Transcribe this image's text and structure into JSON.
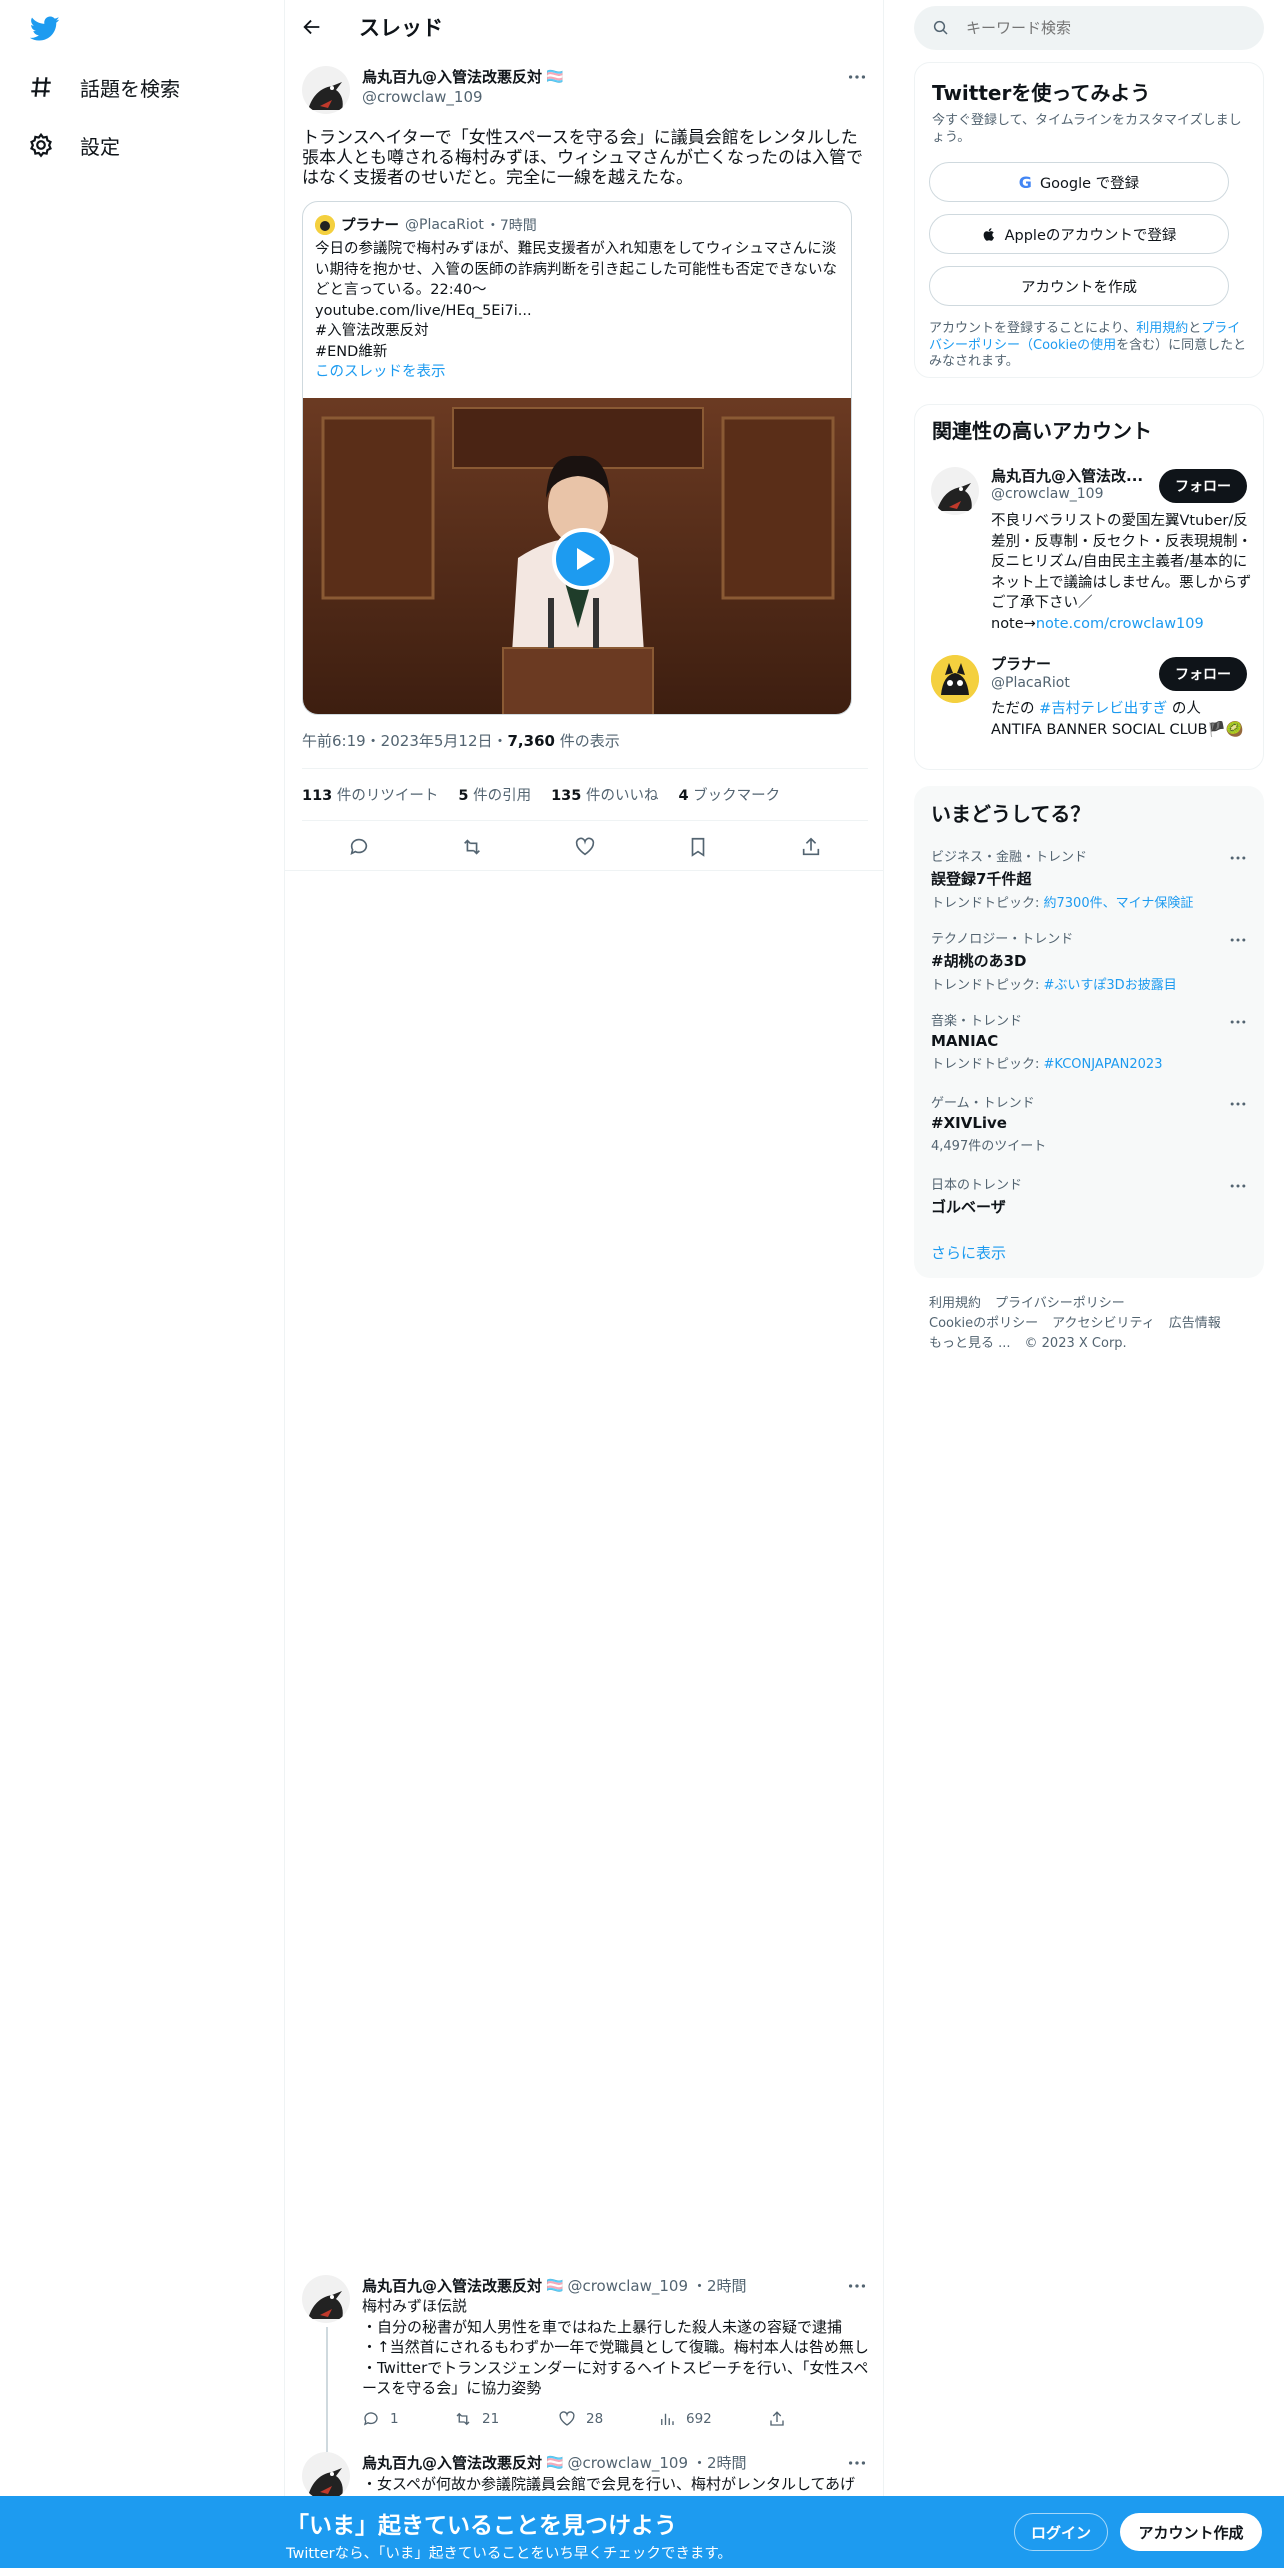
{
  "nav": {
    "explore_label": "話題を検索",
    "settings_label": "設定"
  },
  "header": {
    "title": "スレッド"
  },
  "tweet": {
    "name": "烏丸百九@入管法改悪反対",
    "flag": "🏳️‍⚧️",
    "handle": "@crowclaw_109",
    "text": "トランスヘイターで「女性スペースを守る会」に議員会館をレンタルした張本人とも噂される梅村みずほ、ウィシュマさんが亡くなったのは入管ではなく支援者のせいだと。完全に一線を越えたな。",
    "quote": {
      "name": "プラナー",
      "handle": "@PlacaRiot",
      "time": "・7時間",
      "text_lines": [
        "今日の参議院で梅村みずほが、難民支援者が入れ知恵をしてウィシュマさんに淡い期待を抱かせ、入管の医師の詐病判断を引き起こした可能性も否定できないなどと言っている。22:40〜",
        "youtube.com/live/HEq_5Ei7i...",
        "#入管法改悪反対",
        "#END維新"
      ],
      "show_thread": "このスレッドを表示"
    },
    "time": "午前6:19・2023年5月12日・",
    "views": "7,360",
    "views_label": " 件の表示",
    "retweets": "113",
    "retweets_label": " 件のリツイート",
    "quotes": "5",
    "quotes_label": " 件の引用",
    "likes": "135",
    "likes_label": " 件のいいね",
    "bookmarks": "4",
    "bookmarks_label": " ブックマーク"
  },
  "replies": [
    {
      "name": "烏丸百九@入管法改悪反対",
      "flag": "🏳️‍⚧️",
      "handle": "@crowclaw_109",
      "time": "・2時間",
      "text_lines": [
        "梅村みずほ伝説",
        "・自分の秘書が知人男性を車ではねた上暴行した殺人未遂の容疑で逮捕",
        "・↑当然首にされるもわずか一年で党職員として復職。梅村本人は咎め無し",
        "・Twitterでトランスジェンダーに対するヘイトスピーチを行い、「女性スペースを守る会」に協力姿勢"
      ],
      "replies": "1",
      "retweets": "21",
      "likes": "28",
      "views": "692"
    },
    {
      "name": "烏丸百九@入管法改悪反対",
      "flag": "🏳️‍⚧️",
      "handle": "@crowclaw_109",
      "time": "・2時間",
      "text_lines": [
        "・女スペが何故か参議院議員会館で会見を行い、梅村がレンタルしてあげ"
      ]
    }
  ],
  "right": {
    "search_placeholder": "キーワード検索",
    "signup": {
      "title": "Twitterを使ってみよう",
      "subtitle": "今すぐ登録して、タイムラインをカスタマイズしましょう。",
      "google": "Google で登録",
      "apple": "Appleのアカウントで登録",
      "create": "アカウントを作成",
      "terms_pre": "アカウントを登録することにより、",
      "terms_link1": "利用規約",
      "terms_mid": "と",
      "terms_link2": "プライバシーポリシー（Cookieの使用",
      "terms_post": "を含む）に同意したとみなされます。"
    },
    "related": {
      "title": "関連性の高いアカウント",
      "accounts": [
        {
          "name": "烏丸百九@入管法改...",
          "handle": "@crowclaw_109",
          "follow": "フォロー",
          "bio": "不良リベラリストの愛国左翼Vtuber/反差別・反専制・反セクト・反表現規制・反ニヒリズム/自由民主主義者/基本的にネット上で議論はしません。悪しからずご了承下さい／note→",
          "bio_link": "note.com/crowclaw109"
        },
        {
          "name": "プラナー",
          "handle": "@PlacaRiot",
          "follow": "フォロー",
          "bio_pre": "ただの ",
          "bio_link": "#吉村テレビ出すぎ",
          "bio_post": " の人 ANTIFA BANNER SOCIAL CLUB🏴🥝"
        }
      ]
    },
    "trends": {
      "title": "いまどうしてる？",
      "items": [
        {
          "category": "ビジネス・金融・トレンド",
          "name": "誤登録7千件超",
          "sub_pre": "トレンドトピック: ",
          "sub_link": "約7300件、マイナ保険証"
        },
        {
          "category": "テクノロジー・トレンド",
          "name": "#胡桃のあ3D",
          "sub_pre": "トレンドトピック: ",
          "sub_link": "#ぶいすぽ3Dお披露目"
        },
        {
          "category": "音楽・トレンド",
          "name": "MANIAC",
          "sub_pre": "トレンドトピック: ",
          "sub_link": "#KCONJAPAN2023"
        },
        {
          "category": "ゲーム・トレンド",
          "name": "#XIVLive",
          "sub_pre": "4,497件のツイート",
          "sub_link": ""
        },
        {
          "category": "日本のトレンド",
          "name": "ゴルベーザ",
          "sub_pre": "",
          "sub_link": ""
        }
      ],
      "show_more": "さらに表示"
    },
    "footer": {
      "line1": [
        "利用規約",
        "プライバシーポリシー"
      ],
      "line2": [
        "Cookieのポリシー",
        "アクセシビリティ",
        "広告情報"
      ],
      "line3": [
        "もっと見る ...",
        "© 2023 X Corp."
      ]
    }
  },
  "bottom_bar": {
    "title": "「いま」起きていることを見つけよう",
    "subtitle": "Twitterなら、「いま」起きていることをいち早くチェックできます。",
    "login": "ログイン",
    "signup": "アカウント作成"
  },
  "colors": {
    "accent": "#1d9bf0",
    "text": "#0f1419",
    "muted": "#536471"
  }
}
